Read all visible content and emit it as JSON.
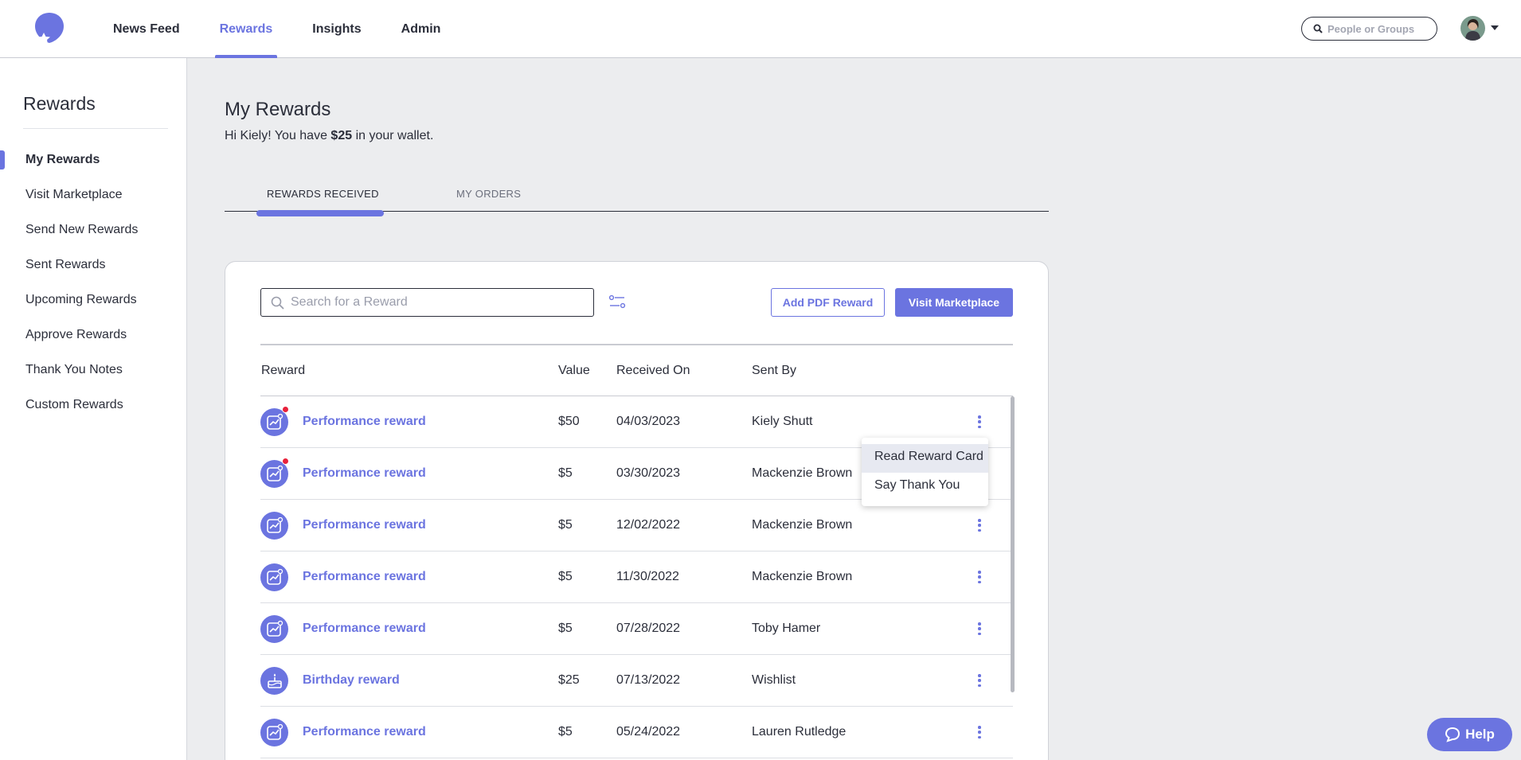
{
  "nav": {
    "links": [
      "News Feed",
      "Rewards",
      "Insights",
      "Admin"
    ],
    "active": "Rewards",
    "search_placeholder": "People or Groups",
    "logo_icon": "balloon-star-logo",
    "avatar_icon": "user-avatar"
  },
  "sidebar": {
    "title": "Rewards",
    "items": [
      "My Rewards",
      "Visit Marketplace",
      "Send New Rewards",
      "Sent Rewards",
      "Upcoming Rewards",
      "Approve Rewards",
      "Thank You Notes",
      "Custom Rewards"
    ],
    "active": "My Rewards"
  },
  "main": {
    "title": "My Rewards",
    "wallet_prefix": "Hi Kiely! You have ",
    "wallet_amount": "$25",
    "wallet_suffix": " in your wallet.",
    "tabs": [
      "REWARDS RECEIVED",
      "MY ORDERS"
    ],
    "active_tab": "REWARDS RECEIVED"
  },
  "card": {
    "search_placeholder": "Search for a Reward",
    "add_pdf_label": "Add PDF Reward",
    "visit_marketplace_label": "Visit Marketplace",
    "columns": [
      "Reward",
      "Value",
      "Received On",
      "Sent By"
    ],
    "rows": [
      {
        "name": "Performance reward",
        "value": "$50",
        "date": "04/03/2023",
        "sender": "Kiely Shutt",
        "icon": "chart-icon",
        "unread": true
      },
      {
        "name": "Performance reward",
        "value": "$5",
        "date": "03/30/2023",
        "sender": "Mackenzie Brown",
        "icon": "chart-icon",
        "unread": true
      },
      {
        "name": "Performance reward",
        "value": "$5",
        "date": "12/02/2022",
        "sender": "Mackenzie Brown",
        "icon": "chart-icon",
        "unread": false
      },
      {
        "name": "Performance reward",
        "value": "$5",
        "date": "11/30/2022",
        "sender": "Mackenzie Brown",
        "icon": "chart-icon",
        "unread": false
      },
      {
        "name": "Performance reward",
        "value": "$5",
        "date": "07/28/2022",
        "sender": "Toby Hamer",
        "icon": "chart-icon",
        "unread": false
      },
      {
        "name": "Birthday reward",
        "value": "$25",
        "date": "07/13/2022",
        "sender": "Wishlist",
        "icon": "cake-icon",
        "unread": false
      },
      {
        "name": "Performance reward",
        "value": "$5",
        "date": "05/24/2022",
        "sender": "Lauren Rutledge",
        "icon": "chart-icon",
        "unread": false
      }
    ]
  },
  "dropdown": {
    "items": [
      "Read Reward Card",
      "Say Thank You"
    ],
    "highlighted": "Read Reward Card"
  },
  "help": {
    "label": "Help"
  },
  "colors": {
    "accent": "#6b74e0",
    "text": "#2b2e3a",
    "background": "#ecedef",
    "unread_dot": "#e8213b"
  }
}
